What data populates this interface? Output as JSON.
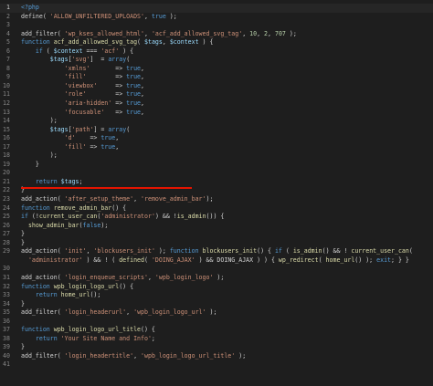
{
  "theme": {
    "background": "#1e1e1e",
    "line_number": "#858585",
    "default_text": "#d4d4d4",
    "keyword": "#569cd6",
    "function": "#dcdcaa",
    "string": "#ce9178",
    "variable": "#9cdcfe",
    "number": "#b5cea8",
    "php_tag": "#569cd6",
    "error_squiggle": "#e51400"
  },
  "editor": {
    "lines": [
      {
        "n": "1",
        "tokens": [
          [
            "<?php",
            "kw"
          ]
        ]
      },
      {
        "n": "2",
        "tokens": [
          [
            "define( ",
            "d"
          ],
          [
            "'ALLOW_UNFILTERED_UPLOADS'",
            "s"
          ],
          [
            ", ",
            "d"
          ],
          [
            "true",
            "kw"
          ],
          [
            " );",
            "d"
          ]
        ]
      },
      {
        "n": "3",
        "tokens": []
      },
      {
        "n": "4",
        "tokens": [
          [
            "add_filter( ",
            "d"
          ],
          [
            "'wp_kses_allowed_html'",
            "s"
          ],
          [
            ", ",
            "d"
          ],
          [
            "'acf_add_allowed_svg_tag'",
            "s"
          ],
          [
            ", ",
            "d"
          ],
          [
            "10",
            "num"
          ],
          [
            ", ",
            "d"
          ],
          [
            "2",
            "num"
          ],
          [
            ", ",
            "d"
          ],
          [
            "707",
            "num"
          ],
          [
            " );",
            "d"
          ]
        ]
      },
      {
        "n": "5",
        "tokens": [
          [
            "function ",
            "kw"
          ],
          [
            "acf_add_allowed_svg_tag",
            "fn"
          ],
          [
            "( ",
            "d"
          ],
          [
            "$tags",
            "v"
          ],
          [
            ", ",
            "d"
          ],
          [
            "$context",
            "v"
          ],
          [
            " ) {",
            "d"
          ]
        ]
      },
      {
        "n": "6",
        "tokens": [
          [
            "    if ",
            "kw"
          ],
          [
            "( ",
            "d"
          ],
          [
            "$context",
            "v"
          ],
          [
            " === ",
            "d"
          ],
          [
            "'acf'",
            "s"
          ],
          [
            " ) {",
            "d"
          ]
        ]
      },
      {
        "n": "7",
        "tokens": [
          [
            "        ",
            "d"
          ],
          [
            "$tags",
            "v"
          ],
          [
            "[",
            "d"
          ],
          [
            "'svg'",
            "s"
          ],
          [
            "]  = ",
            "d"
          ],
          [
            "array",
            "kw"
          ],
          [
            "(",
            "d"
          ]
        ]
      },
      {
        "n": "8",
        "tokens": [
          [
            "            ",
            "d"
          ],
          [
            "'xmlns'",
            "s"
          ],
          [
            "       => ",
            "d"
          ],
          [
            "true",
            "kw"
          ],
          [
            ",",
            "d"
          ]
        ]
      },
      {
        "n": "9",
        "tokens": [
          [
            "            ",
            "d"
          ],
          [
            "'fill'",
            "s"
          ],
          [
            "        => ",
            "d"
          ],
          [
            "true",
            "kw"
          ],
          [
            ",",
            "d"
          ]
        ]
      },
      {
        "n": "10",
        "tokens": [
          [
            "            ",
            "d"
          ],
          [
            "'viewbox'",
            "s"
          ],
          [
            "     => ",
            "d"
          ],
          [
            "true",
            "kw"
          ],
          [
            ",",
            "d"
          ]
        ]
      },
      {
        "n": "11",
        "tokens": [
          [
            "            ",
            "d"
          ],
          [
            "'role'",
            "s"
          ],
          [
            "        => ",
            "d"
          ],
          [
            "true",
            "kw"
          ],
          [
            ",",
            "d"
          ]
        ]
      },
      {
        "n": "12",
        "tokens": [
          [
            "            ",
            "d"
          ],
          [
            "'aria-hidden'",
            "s"
          ],
          [
            " => ",
            "d"
          ],
          [
            "true",
            "kw"
          ],
          [
            ",",
            "d"
          ]
        ]
      },
      {
        "n": "13",
        "tokens": [
          [
            "            ",
            "d"
          ],
          [
            "'focusable'",
            "s"
          ],
          [
            "   => ",
            "d"
          ],
          [
            "true",
            "kw"
          ],
          [
            ",",
            "d"
          ]
        ]
      },
      {
        "n": "14",
        "tokens": [
          [
            "        );",
            "d"
          ]
        ]
      },
      {
        "n": "15",
        "tokens": [
          [
            "        ",
            "d"
          ],
          [
            "$tags",
            "v"
          ],
          [
            "[",
            "d"
          ],
          [
            "'path'",
            "s"
          ],
          [
            "] = ",
            "d"
          ],
          [
            "array",
            "kw"
          ],
          [
            "(",
            "d"
          ]
        ]
      },
      {
        "n": "16",
        "tokens": [
          [
            "            ",
            "d"
          ],
          [
            "'d'",
            "s"
          ],
          [
            "    => ",
            "d"
          ],
          [
            "true",
            "kw"
          ],
          [
            ",",
            "d"
          ]
        ]
      },
      {
        "n": "17",
        "tokens": [
          [
            "            ",
            "d"
          ],
          [
            "'fill'",
            "s"
          ],
          [
            " => ",
            "d"
          ],
          [
            "true",
            "kw"
          ],
          [
            ",",
            "d"
          ]
        ]
      },
      {
        "n": "18",
        "tokens": [
          [
            "        );",
            "d"
          ]
        ]
      },
      {
        "n": "19",
        "tokens": [
          [
            "    }",
            "d"
          ]
        ]
      },
      {
        "n": "20",
        "tokens": []
      },
      {
        "n": "21",
        "tokens": [
          [
            "    return ",
            "kw"
          ],
          [
            "$tags",
            "v"
          ],
          [
            ";",
            "d"
          ]
        ]
      },
      {
        "n": "22",
        "tokens": [
          [
            "}",
            "d"
          ]
        ]
      },
      {
        "n": "23",
        "tokens": [
          [
            "add_action( ",
            "d"
          ],
          [
            "'after_setup_theme'",
            "s"
          ],
          [
            ", ",
            "d"
          ],
          [
            "'remove_admin_bar'",
            "s"
          ],
          [
            ");",
            "d"
          ]
        ]
      },
      {
        "n": "24",
        "tokens": [
          [
            "function ",
            "kw"
          ],
          [
            "remove_admin_bar",
            "fn"
          ],
          [
            "() {",
            "d"
          ]
        ]
      },
      {
        "n": "25",
        "tokens": [
          [
            "if ",
            "kw"
          ],
          [
            "(!",
            "d"
          ],
          [
            "current_user_can",
            "fn"
          ],
          [
            "(",
            "d"
          ],
          [
            "'administrator'",
            "s"
          ],
          [
            ") && !",
            "d"
          ],
          [
            "is_admin",
            "fn"
          ],
          [
            "()) {",
            "d"
          ]
        ]
      },
      {
        "n": "26",
        "tokens": [
          [
            "  ",
            "d"
          ],
          [
            "show_admin_bar",
            "fn"
          ],
          [
            "(",
            "d"
          ],
          [
            "false",
            "kw"
          ],
          [
            ");",
            "d"
          ]
        ]
      },
      {
        "n": "27",
        "tokens": [
          [
            "}",
            "d"
          ]
        ]
      },
      {
        "n": "28",
        "tokens": [
          [
            "}",
            "d"
          ]
        ]
      },
      {
        "n": "29",
        "tokens": [
          [
            "add_action( ",
            "d"
          ],
          [
            "'init'",
            "s"
          ],
          [
            ", ",
            "d"
          ],
          [
            "'blockusers_init'",
            "s"
          ],
          [
            " ); ",
            "d"
          ],
          [
            "function ",
            "kw"
          ],
          [
            "blockusers_init",
            "fn"
          ],
          [
            "() { ",
            "d"
          ],
          [
            "if ",
            "kw"
          ],
          [
            "( ",
            "d"
          ],
          [
            "is_admin",
            "fn"
          ],
          [
            "() && ! ",
            "d"
          ],
          [
            "current_user_can",
            "fn"
          ],
          [
            "(",
            "d"
          ]
        ]
      },
      {
        "n": "",
        "tokens": [
          [
            "  ",
            "d"
          ],
          [
            "'administrator'",
            "s"
          ],
          [
            " ) && ! ( ",
            "d"
          ],
          [
            "defined",
            "fn"
          ],
          [
            "( ",
            "d"
          ],
          [
            "'DOING_AJAX'",
            "s"
          ],
          [
            " ) && DOING_AJAX ) ) { ",
            "d"
          ],
          [
            "wp_redirect",
            "fn"
          ],
          [
            "( ",
            "d"
          ],
          [
            "home_url",
            "fn"
          ],
          [
            "() ); ",
            "d"
          ],
          [
            "exit",
            "kw"
          ],
          [
            "; } }",
            "d"
          ]
        ]
      },
      {
        "n": "30",
        "tokens": []
      },
      {
        "n": "31",
        "tokens": [
          [
            "add_action( ",
            "d"
          ],
          [
            "'login_enqueue_scripts'",
            "s"
          ],
          [
            ", ",
            "d"
          ],
          [
            "'wpb_login_logo'",
            "s"
          ],
          [
            " );",
            "d"
          ]
        ]
      },
      {
        "n": "32",
        "tokens": [
          [
            "function ",
            "kw"
          ],
          [
            "wpb_login_logo_url",
            "fn"
          ],
          [
            "() {",
            "d"
          ]
        ]
      },
      {
        "n": "33",
        "tokens": [
          [
            "    return ",
            "kw"
          ],
          [
            "home_url",
            "fn"
          ],
          [
            "();",
            "d"
          ]
        ]
      },
      {
        "n": "34",
        "tokens": [
          [
            "}",
            "d"
          ]
        ]
      },
      {
        "n": "35",
        "tokens": [
          [
            "add_filter( ",
            "d"
          ],
          [
            "'login_headerurl'",
            "s"
          ],
          [
            ", ",
            "d"
          ],
          [
            "'wpb_login_logo_url'",
            "s"
          ],
          [
            " );",
            "d"
          ]
        ]
      },
      {
        "n": "36",
        "tokens": []
      },
      {
        "n": "37",
        "tokens": [
          [
            "function ",
            "kw"
          ],
          [
            "wpb_login_logo_url_title",
            "fn"
          ],
          [
            "() {",
            "d"
          ]
        ]
      },
      {
        "n": "38",
        "tokens": [
          [
            "    return ",
            "kw"
          ],
          [
            "'Your Site Name and Info'",
            "s"
          ],
          [
            ";",
            "d"
          ]
        ]
      },
      {
        "n": "39",
        "tokens": [
          [
            "}",
            "d"
          ]
        ]
      },
      {
        "n": "40",
        "tokens": [
          [
            "add_filter( ",
            "d"
          ],
          [
            "'login_headertitle'",
            "s"
          ],
          [
            ", ",
            "d"
          ],
          [
            "'wpb_login_logo_url_title'",
            "s"
          ],
          [
            " );",
            "d"
          ]
        ]
      },
      {
        "n": "41",
        "tokens": []
      }
    ]
  }
}
